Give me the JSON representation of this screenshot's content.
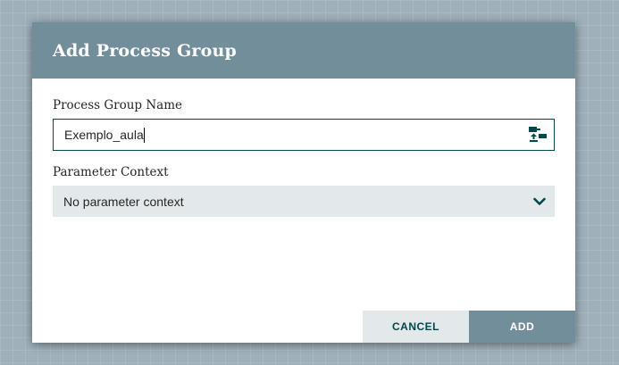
{
  "dialog": {
    "title": "Add Process Group",
    "name_field": {
      "label": "Process Group Name",
      "value": "Exemplo_aula",
      "icon": "upload-process-group-icon"
    },
    "parameter_context": {
      "label": "Parameter Context",
      "selected": "No parameter context",
      "icon": "chevron-down-icon"
    },
    "buttons": {
      "cancel": "CANCEL",
      "add": "ADD"
    }
  },
  "colors": {
    "header": "#728e9b",
    "accent": "#004849",
    "select_bg": "#e3e8eb",
    "backdrop": "#9fb0bb"
  }
}
